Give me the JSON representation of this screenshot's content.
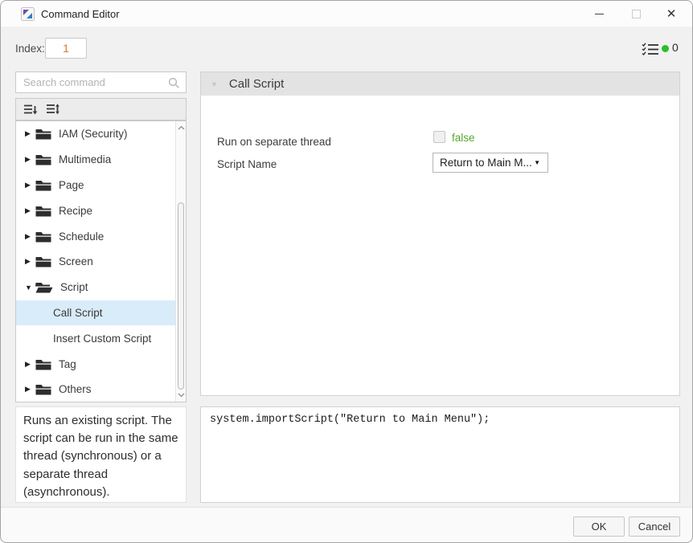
{
  "window": {
    "title": "Command Editor",
    "controls": {
      "close_glyph": "✕"
    }
  },
  "toolbar": {
    "index_label": "Index:",
    "index_value": "1",
    "command_count": "0"
  },
  "sidebar": {
    "search_placeholder": "Search command",
    "tree": [
      {
        "label": "IAM (Security)",
        "type": "folder",
        "expanded": false
      },
      {
        "label": "Multimedia",
        "type": "folder",
        "expanded": false
      },
      {
        "label": "Page",
        "type": "folder",
        "expanded": false
      },
      {
        "label": "Recipe",
        "type": "folder",
        "expanded": false
      },
      {
        "label": "Schedule",
        "type": "folder",
        "expanded": false
      },
      {
        "label": "Screen",
        "type": "folder",
        "expanded": false
      },
      {
        "label": "Script",
        "type": "folder",
        "expanded": true
      },
      {
        "label": "Call Script",
        "type": "leaf",
        "selected": true
      },
      {
        "label": "Insert Custom Script",
        "type": "leaf",
        "selected": false
      },
      {
        "label": "Tag",
        "type": "folder",
        "expanded": false
      },
      {
        "label": "Others",
        "type": "folder",
        "expanded": false
      }
    ],
    "description": "Runs an existing script. The script can be run in the same thread (synchronous) or a separate thread (asynchronous)."
  },
  "editor": {
    "panel_title": "Call Script",
    "run_on_separate_thread_label": "Run on separate thread",
    "run_on_separate_thread_value": "false",
    "run_on_separate_thread_checked": false,
    "script_name_label": "Script Name",
    "script_name_value": "Return to Main M...",
    "code": "system.importScript(\"Return to Main Menu\");"
  },
  "footer": {
    "ok_label": "OK",
    "cancel_label": "Cancel"
  },
  "icons": {
    "collapsed_arrow": "▶",
    "expanded_arrow": "▼",
    "panel_collapse_arrow": "▼",
    "dropdown_arrow": "▼"
  },
  "colors": {
    "value_green": "#55a82d",
    "index_orange": "#d9782d",
    "selection_blue": "#d9ecf9",
    "status_dot_green": "#28c028"
  }
}
